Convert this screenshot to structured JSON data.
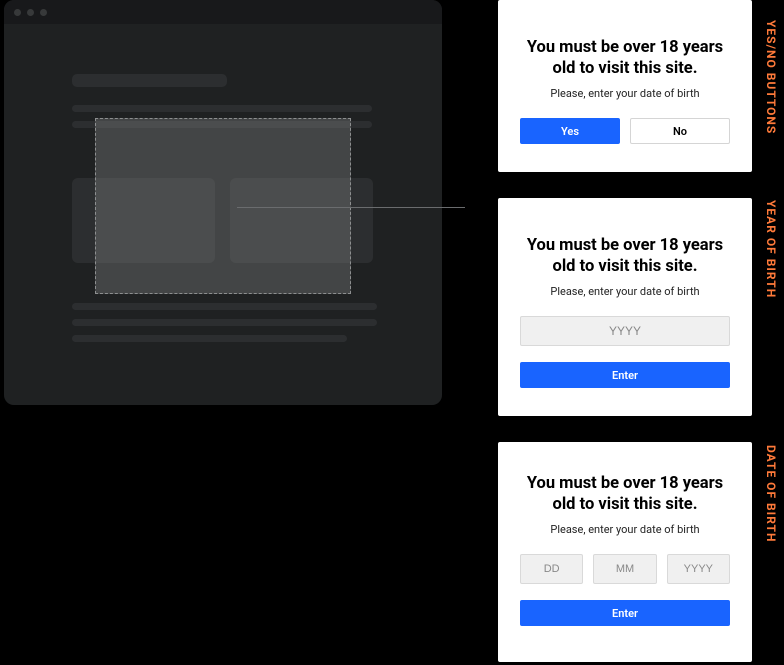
{
  "labels": {
    "section1": "YES/NO BUTTONS",
    "section2": "YEAR OF BIRTH",
    "section3": "DATE OF BIRTH"
  },
  "common": {
    "heading": "You must be over 18 years old to visit this site.",
    "subtext": "Please, enter your date of birth"
  },
  "yesno": {
    "yes": "Yes",
    "no": "No"
  },
  "year": {
    "placeholder": "YYYY",
    "enter": "Enter"
  },
  "dob": {
    "dd": "DD",
    "mm": "MM",
    "yyyy": "YYYY",
    "enter": "Enter"
  }
}
